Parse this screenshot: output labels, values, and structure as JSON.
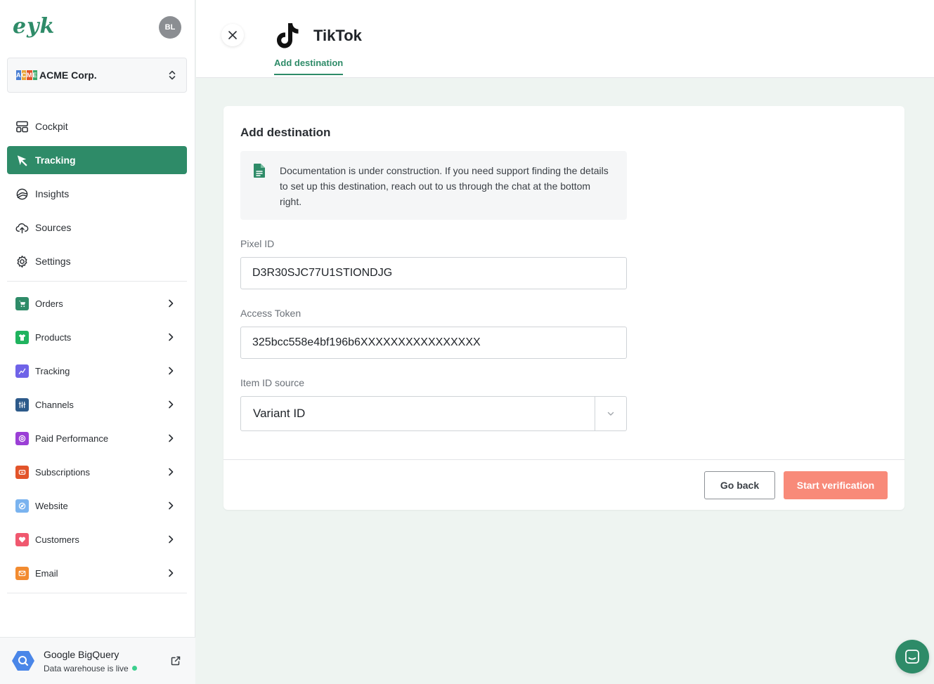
{
  "app": {
    "logo": "eyk",
    "avatar_initials": "BL"
  },
  "org": {
    "name": "ACME Corp.",
    "logo_letters": [
      "A",
      "C",
      "M",
      "E"
    ]
  },
  "nav": [
    {
      "label": "Cockpit",
      "icon": "layout-icon"
    },
    {
      "label": "Tracking",
      "icon": "cursor-icon",
      "active": true
    },
    {
      "label": "Insights",
      "icon": "insights-icon"
    },
    {
      "label": "Sources",
      "icon": "cloud-upload-icon"
    },
    {
      "label": "Settings",
      "icon": "gear-icon"
    }
  ],
  "subnav": [
    {
      "label": "Orders",
      "icon": "cart-icon",
      "color": "#2e8b68"
    },
    {
      "label": "Products",
      "icon": "shirt-icon",
      "color": "#1fb35e"
    },
    {
      "label": "Tracking",
      "icon": "trend-icon",
      "color": "#6f63e8"
    },
    {
      "label": "Channels",
      "icon": "sliders-icon",
      "color": "#2d5a8a"
    },
    {
      "label": "Paid Performance",
      "icon": "target-icon",
      "color": "#9b3fd6"
    },
    {
      "label": "Subscriptions",
      "icon": "repeat-icon",
      "color": "#e2542a"
    },
    {
      "label": "Website",
      "icon": "compass-icon",
      "color": "#7ab3ef"
    },
    {
      "label": "Customers",
      "icon": "heart-icon",
      "color": "#f0586f"
    },
    {
      "label": "Email",
      "icon": "mail-icon",
      "color": "#f28b30"
    }
  ],
  "footer": {
    "title": "Google BigQuery",
    "status": "Data warehouse is live"
  },
  "header": {
    "title": "TikTok",
    "tab": "Add destination"
  },
  "card": {
    "title": "Add destination",
    "note": "Documentation is under construction. If you need support finding the details to set up this destination, reach out to us through the chat at the bottom right.",
    "pixel_label": "Pixel ID",
    "pixel_value": "D3R30SJC77U1STIONDJG",
    "token_label": "Access Token",
    "token_value": "325bcc558e4bf196b6XXXXXXXXXXXXXXXX",
    "item_label": "Item ID source",
    "item_value": "Variant ID",
    "back_label": "Go back",
    "start_label": "Start verification"
  },
  "colors": {
    "brand": "#2e8b68",
    "cta": "#f88a79"
  }
}
